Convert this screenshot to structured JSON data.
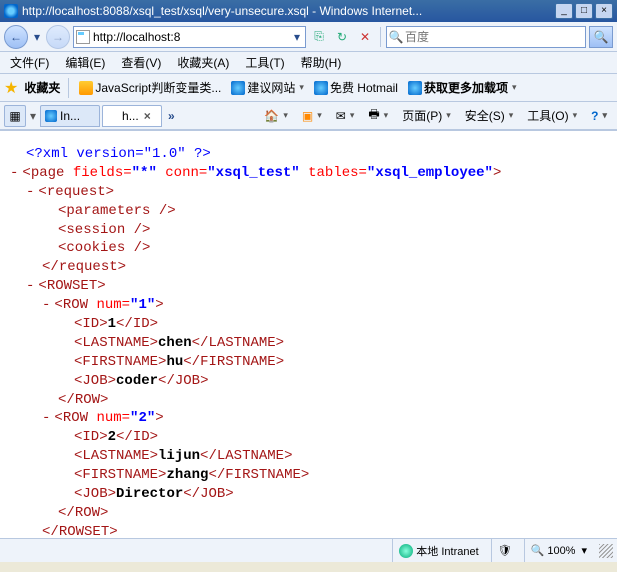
{
  "window": {
    "title": "http://localhost:8088/xsql_test/xsql/very-unsecure.xsql - Windows Internet..."
  },
  "nav": {
    "url": "http://localhost:8",
    "search_placeholder": "百度"
  },
  "menu": {
    "file": "文件(F)",
    "edit": "编辑(E)",
    "view": "查看(V)",
    "favorites": "收藏夹(A)",
    "tools": "工具(T)",
    "help": "帮助(H)"
  },
  "fav": {
    "label": "收藏夹",
    "js": "JavaScript判断变量类...",
    "suggest": "建议网站",
    "hotmail": "免费 Hotmail",
    "more": "获取更多加载项"
  },
  "tabs": {
    "t1": "In...",
    "t2": "h...",
    "overflow": "»",
    "page": "页面(P)",
    "safety": "安全(S)",
    "tools": "工具(O)"
  },
  "xml": {
    "pi": "<?xml version=\"1.0\" ?>",
    "page_open": "page",
    "fields_a": "fields=",
    "fields_v": "\"*\"",
    "conn_a": "conn=",
    "conn_v": "\"xsql_test\"",
    "tables_a": "tables=",
    "tables_v": "\"xsql_employee\"",
    "request": "request",
    "parameters": "parameters",
    "session": "session",
    "cookies": "cookies",
    "rowset": "ROWSET",
    "row": "ROW",
    "num_a": "num=",
    "row1_num": "\"1\"",
    "row2_num": "\"2\"",
    "id": "ID",
    "lastname": "LASTNAME",
    "firstname": "FIRSTNAME",
    "job": "JOB",
    "r1_id": "1",
    "r1_ln": "chen",
    "r1_fn": "hu",
    "r1_job": "coder",
    "r2_id": "2",
    "r2_ln": "lijun",
    "r2_fn": "zhang",
    "r2_job": "Director"
  },
  "status": {
    "zone": "本地 Intranet",
    "zoom": "100%"
  }
}
